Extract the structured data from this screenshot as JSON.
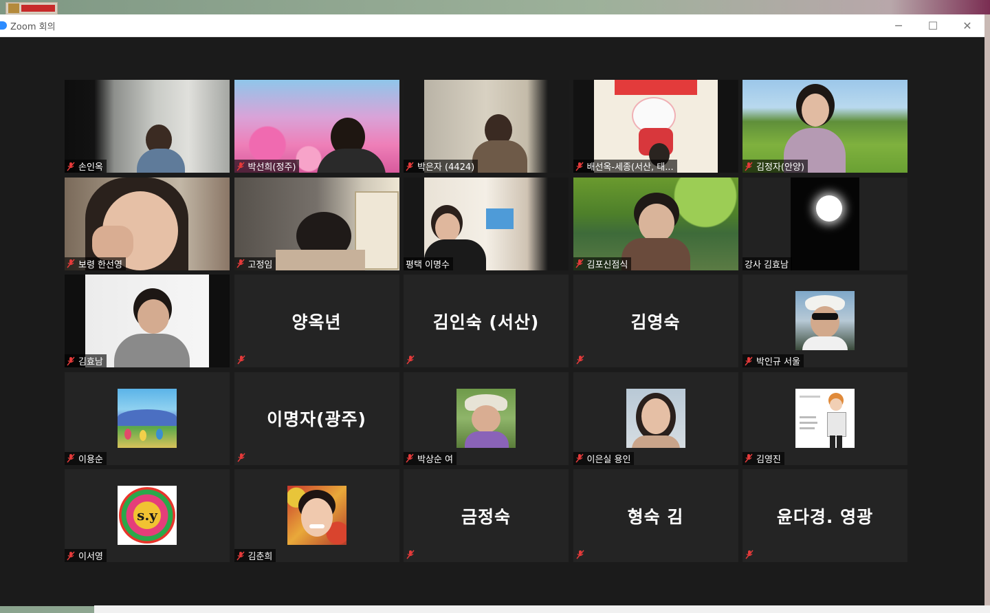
{
  "window": {
    "title": "Zoom 회의",
    "controls": {
      "minimize": "─",
      "maximize": "☐",
      "close": "✕"
    }
  },
  "colors": {
    "mute_red": "#e43a3a",
    "tile_bg": "#242424",
    "window_bg": "#1b1b1b",
    "zoom_blue": "#2d8cff"
  },
  "participants": [
    {
      "name": "손인옥",
      "kind": "video",
      "muted": true
    },
    {
      "name": "박선희(정주)",
      "kind": "video",
      "muted": true
    },
    {
      "name": "박은자 (4424)",
      "kind": "video",
      "muted": true
    },
    {
      "name": "배선옥-세종(서산, 태...",
      "kind": "video",
      "muted": true
    },
    {
      "name": "김정자(안양)",
      "kind": "video",
      "muted": true
    },
    {
      "name": "보령 한선영",
      "kind": "video",
      "muted": true
    },
    {
      "name": "고정임",
      "kind": "video",
      "muted": true
    },
    {
      "name": "평택 이명수",
      "kind": "video",
      "muted": false
    },
    {
      "name": "김포신점식",
      "kind": "video",
      "muted": true
    },
    {
      "name": "강사 김효남",
      "kind": "video",
      "muted": false
    },
    {
      "name": "김효남",
      "kind": "video",
      "muted": true
    },
    {
      "name": "양옥년",
      "kind": "name",
      "muted": true
    },
    {
      "name": "김인숙 (서산)",
      "kind": "name",
      "muted": true
    },
    {
      "name": "김영숙",
      "kind": "name",
      "muted": true
    },
    {
      "name": "박인규 서울",
      "kind": "avatar",
      "muted": true
    },
    {
      "name": "이용순",
      "kind": "avatar",
      "muted": true
    },
    {
      "name": "이명자(광주)",
      "kind": "name",
      "muted": true
    },
    {
      "name": "박상순 여",
      "kind": "avatar",
      "muted": true
    },
    {
      "name": "이은실 용인",
      "kind": "avatar",
      "muted": true
    },
    {
      "name": "김영진",
      "kind": "avatar",
      "muted": true
    },
    {
      "name": "이서영",
      "kind": "avatar",
      "muted": true,
      "avatar_text": "s.y"
    },
    {
      "name": "김춘희",
      "kind": "avatar",
      "muted": true
    },
    {
      "name": "금정숙",
      "kind": "name",
      "muted": true
    },
    {
      "name": "형숙 김",
      "kind": "name",
      "muted": true
    },
    {
      "name": "윤다경. 영광",
      "kind": "name",
      "muted": true
    }
  ]
}
